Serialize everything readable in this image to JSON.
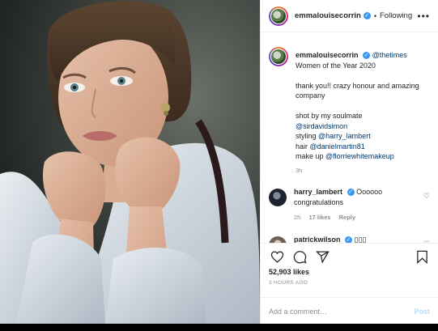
{
  "header": {
    "username": "emmalouisecorrin",
    "follow_state": "Following",
    "separator": "•",
    "more": "•••"
  },
  "caption": {
    "username": "emmalouisecorrin",
    "mention_head": "@thetimes",
    "line1": "Women of the Year 2020",
    "line2": "thank you!! crazy honour and amazing company",
    "line3": "shot by my soulmate",
    "photographer": "@sirdavidsimon",
    "styling_prefix": "styling",
    "stylist": "@harry_lambert",
    "hair_prefix": "hair",
    "hair": "@danielmartin81",
    "makeup_prefix": "make up",
    "makeup": "@florriewhitemakeup",
    "time": "3h"
  },
  "comments": [
    {
      "username": "harry_lambert",
      "text": "Oooooo congratulations",
      "time": "2h",
      "likes": "17 likes",
      "reply": "Reply"
    },
    {
      "username": "patrickwilson",
      "text": "▯▯▯"
    }
  ],
  "likes": "52,903 likes",
  "posted": "3 HOURS AGO",
  "add_comment": {
    "placeholder": "Add a comment…",
    "post_label": "Post"
  },
  "icons": [
    "heart-icon",
    "comment-icon",
    "share-icon",
    "bookmark-icon",
    "more-icon",
    "verified-icon"
  ],
  "colors": {
    "verified": "#3897f0",
    "mention": "#00376b",
    "post_disabled": "#b2dffc",
    "muted": "#8e8e8e"
  }
}
